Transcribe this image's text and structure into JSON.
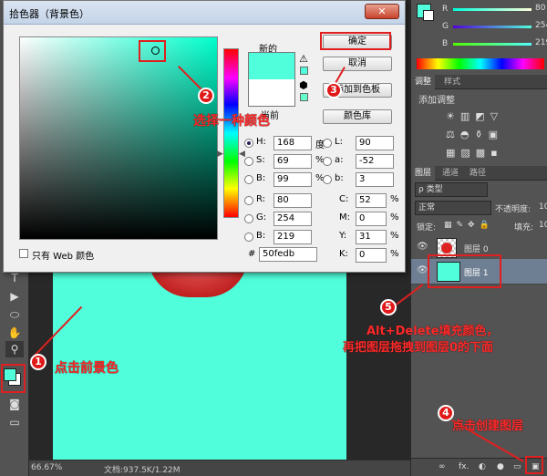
{
  "dialog": {
    "title": "拾色器（背景色）",
    "new_label": "新的",
    "current_label": "当前",
    "ok_label": "确定",
    "cancel_label": "取消",
    "add_swatch_label": "添加到色板",
    "color_library_label": "颜色库",
    "web_only_label": "只有 Web 颜色",
    "new_color": "#50fedb",
    "current_color": "#ffffff",
    "hsb": {
      "h_label": "H:",
      "h": "168",
      "h_unit": "度",
      "s_label": "S:",
      "s": "69",
      "s_unit": "%",
      "b_label": "B:",
      "b": "99",
      "b_unit": "%"
    },
    "lab": {
      "l_label": "L:",
      "l": "90",
      "a_label": "a:",
      "a": "-52",
      "b_label": "b:",
      "b": "3"
    },
    "rgb": {
      "r_label": "R:",
      "r": "80",
      "g_label": "G:",
      "g": "254",
      "b_label": "B:",
      "b": "219"
    },
    "cmyk": {
      "c_label": "C:",
      "c": "52",
      "m_label": "M:",
      "m": "0",
      "y_label": "Y:",
      "y": "31",
      "k_label": "K:",
      "k": "0",
      "unit": "%"
    },
    "hex_label": "#",
    "hex": "50fedb"
  },
  "color_panel": {
    "r_label": "R",
    "r": "80",
    "g_label": "G",
    "g": "254",
    "b_label": "B",
    "b": "219",
    "foreground": "#50fedb"
  },
  "adjust_panel": {
    "tabs": [
      "调整",
      "样式"
    ],
    "title": "添加调整"
  },
  "layers_panel": {
    "tabs": [
      "图层",
      "通道",
      "路径"
    ],
    "kind_label": "ρ 类型",
    "blend_mode": "正常",
    "opacity_label": "不透明度:",
    "opacity": "10",
    "lock_label": "锁定:",
    "fill_label": "填充:",
    "fill": "10",
    "layers": [
      {
        "name": "图层 0"
      },
      {
        "name": "图层 1"
      }
    ],
    "bottom_icons": [
      "∞",
      "fx.",
      "◐",
      "●",
      "▭",
      "▣"
    ]
  },
  "status": {
    "zoom": "66.67%",
    "doc": "文档:937.5K/1.22M"
  },
  "annotations": {
    "step1": "点击前景色",
    "step2": "选择一种颜色",
    "step4": "点击创建图层",
    "step5_line1": "Alt+Delete填充颜色，",
    "step5_line2": "再把图层拖拽到图层0的下面",
    "n1": "1",
    "n2": "2",
    "n3": "3",
    "n4": "4",
    "n5": "5"
  }
}
